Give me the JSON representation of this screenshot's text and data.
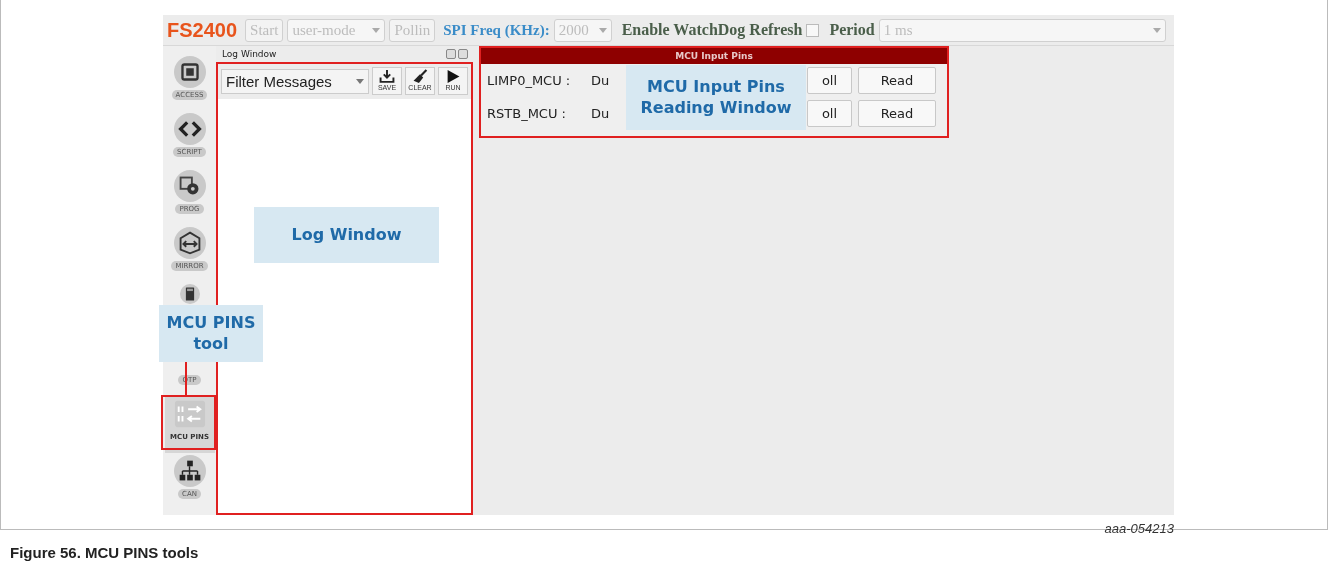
{
  "toolbar": {
    "brand": "FS2400",
    "start_button": {
      "label": "Start",
      "disabled": true
    },
    "mode_select": {
      "value": "user-mode",
      "disabled": true
    },
    "polling_button": {
      "label": "Pollin",
      "disabled": true
    },
    "spi_label": "SPI Freq (KHz):",
    "spi_select": {
      "value": "2000",
      "disabled": true
    },
    "watchdog_label": "Enable WatchDog Refresh",
    "watchdog_checkbox": {
      "checked": false
    },
    "period_label": "Period",
    "period_select": {
      "value": "1 ms",
      "disabled": true
    }
  },
  "sidebar": {
    "items": [
      {
        "kind": "chip",
        "label": "ACCESS",
        "selected": false
      },
      {
        "kind": "code",
        "label": "SCRIPT",
        "selected": false
      },
      {
        "kind": "gear",
        "label": "PROG",
        "selected": false
      },
      {
        "kind": "mirror",
        "label": "MIRROR",
        "selected": false
      },
      {
        "kind": "calculator",
        "selected": false
      },
      {
        "kind": "hidden",
        "label": "OTP",
        "selected": false
      },
      {
        "kind": "pins",
        "label": "MCU PINS",
        "selected": true
      },
      {
        "kind": "network",
        "label": "CAN",
        "selected": false
      }
    ]
  },
  "log_window": {
    "title": "Log Window",
    "filter": {
      "value": "Filter Messages"
    },
    "buttons": [
      {
        "kind": "save",
        "label": "SAVE"
      },
      {
        "kind": "clear",
        "label": "CLEAR"
      },
      {
        "kind": "run",
        "label": "RUN"
      }
    ]
  },
  "mcu_panel": {
    "title": "MCU Input Pins",
    "rows": [
      {
        "name": "LIMP0_MCU :",
        "value": "Du",
        "poll": "oll",
        "read": "Read"
      },
      {
        "name": "RSTB_MCU :",
        "value": "Du",
        "poll": "oll",
        "read": "Read"
      }
    ]
  },
  "callouts": {
    "log": "Log Window",
    "mcu_panel": [
      "MCU Input Pins",
      "Reading Window"
    ],
    "tool": [
      "MCU PINS",
      "tool"
    ]
  },
  "figure": {
    "id": "aaa-054213",
    "caption": "Figure 56.  MCU PINS tools"
  }
}
